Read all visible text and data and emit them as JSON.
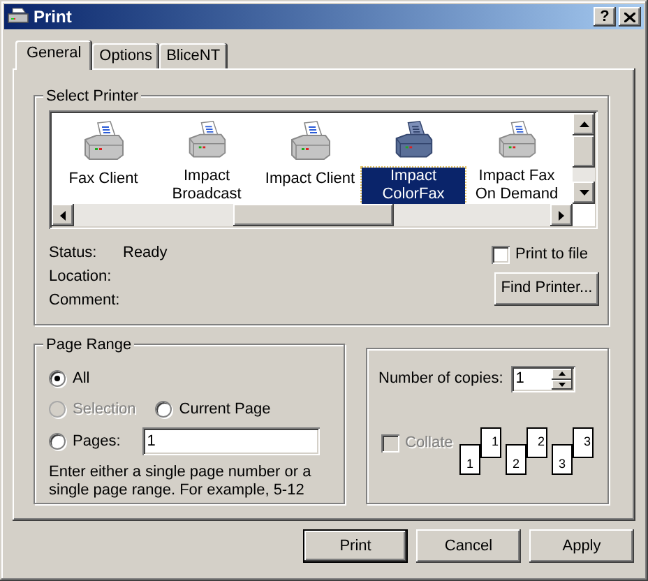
{
  "window": {
    "title": "Print",
    "help_button": "?"
  },
  "tabs": [
    {
      "label": "General",
      "selected": true
    },
    {
      "label": "Options",
      "selected": false
    },
    {
      "label": "BliceNT",
      "selected": false
    }
  ],
  "select_printer": {
    "label": "Select Printer",
    "printers": [
      {
        "name": "Fax Client",
        "selected": false
      },
      {
        "name": "Impact Broadcast",
        "selected": false
      },
      {
        "name": "Impact Client",
        "selected": false
      },
      {
        "name": "Impact ColorFax",
        "selected": true
      },
      {
        "name": "Impact Fax On Demand",
        "selected": false
      }
    ],
    "info": [
      {
        "label": "Status:",
        "value": "Ready"
      },
      {
        "label": "Location:"
      },
      {
        "label": "Comment:"
      }
    ],
    "print_to_file": {
      "label": "Print to file",
      "checked": false
    },
    "find_printer_button": "Find Printer..."
  },
  "page_range": {
    "label": "Page Range",
    "rows": [
      [
        {
          "kind": "radio",
          "label": "All",
          "selected": true,
          "disabled": false
        }
      ],
      [
        {
          "kind": "radio",
          "label": "Selection",
          "selected": false,
          "disabled": true
        },
        {
          "kind": "radio",
          "label": "Current Page",
          "selected": false,
          "disabled": false
        }
      ],
      [
        {
          "kind": "field",
          "label": "Pages:",
          "selected": false,
          "disabled": false,
          "value": "1"
        }
      ]
    ],
    "hint": "Enter either a single page number or a single page range.  For example, 5-12"
  },
  "copies": {
    "label": "Number of copies:",
    "value": "1",
    "collate": {
      "label": "Collate",
      "checked": false,
      "disabled": true
    },
    "collate_sets": [
      {
        "back": "1",
        "front": "1"
      },
      {
        "back": "2",
        "front": "2"
      },
      {
        "back": "3",
        "front": "3"
      }
    ]
  },
  "buttons": [
    {
      "label": "Print",
      "default": true
    },
    {
      "label": "Cancel",
      "default": false
    },
    {
      "label": "Apply",
      "default": false
    }
  ]
}
